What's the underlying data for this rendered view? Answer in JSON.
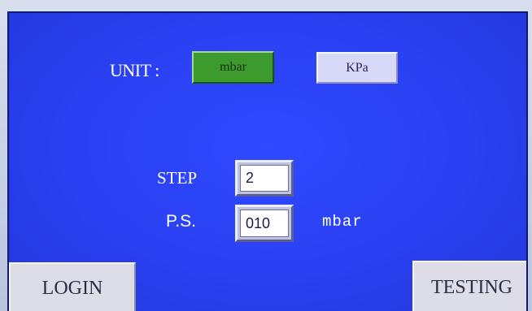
{
  "unit_section": {
    "label": "UNIT :",
    "options": [
      {
        "label": "mbar",
        "selected": true,
        "color": "#3d9a2c"
      },
      {
        "label": "KPa",
        "selected": false,
        "color": "#d8d9f6"
      }
    ]
  },
  "step": {
    "label": "STEP",
    "value": "2"
  },
  "pressure_setpoint": {
    "label": "P.S.",
    "value": "010",
    "unit": "mbar"
  },
  "nav": {
    "login_label": "LOGIN",
    "testing_label": "TESTING"
  },
  "colors": {
    "screen_background": "#2f49ff",
    "text": "#ffffff"
  }
}
